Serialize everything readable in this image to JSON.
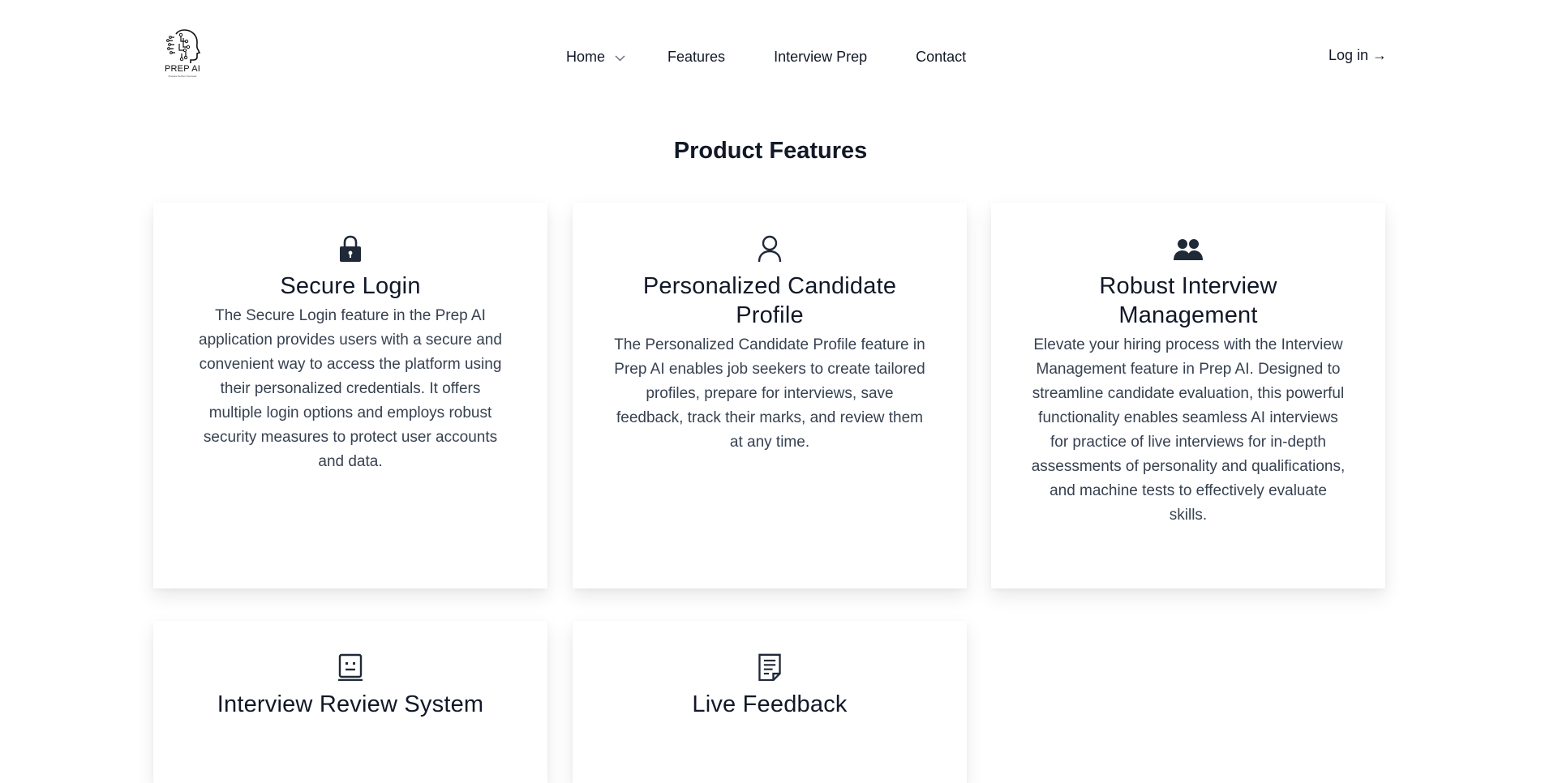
{
  "brand": {
    "name": "PREP AI",
    "tagline": "Prepare Perform Succeed"
  },
  "nav": {
    "items": [
      {
        "label": "Home",
        "has_dropdown": true
      },
      {
        "label": "Features"
      },
      {
        "label": "Interview Prep"
      },
      {
        "label": "Contact"
      }
    ],
    "login_label": "Log in →"
  },
  "main": {
    "title": "Product Features",
    "features": [
      {
        "icon": "lock-icon",
        "title": "Secure Login",
        "description": "The Secure Login feature in the Prep AI application provides users with a secure and convenient way to access the platform using their personalized credentials. It offers multiple login options and employs robust security measures to protect user accounts and data."
      },
      {
        "icon": "user-icon",
        "title": "Personalized Candidate Profile",
        "description": "The Personalized Candidate Profile feature in Prep AI enables job seekers to create tailored profiles, prepare for interviews, save feedback, track their marks, and review them at any time."
      },
      {
        "icon": "users-icon",
        "title": "Robust Interview Management",
        "description": "Elevate your hiring process with the Interview Management feature in Prep AI. Designed to streamline candidate evaluation, this powerful functionality enables seamless AI interviews for practice of live interviews for in-depth assessments of personality and qualifications, and machine tests to effectively evaluate skills."
      },
      {
        "icon": "face-screen-icon",
        "title": "Interview Review System",
        "description": ""
      },
      {
        "icon": "document-icon",
        "title": "Live Feedback",
        "description": ""
      }
    ]
  },
  "colors": {
    "text": "#111827",
    "body_text": "#374151",
    "background": "#ffffff"
  }
}
